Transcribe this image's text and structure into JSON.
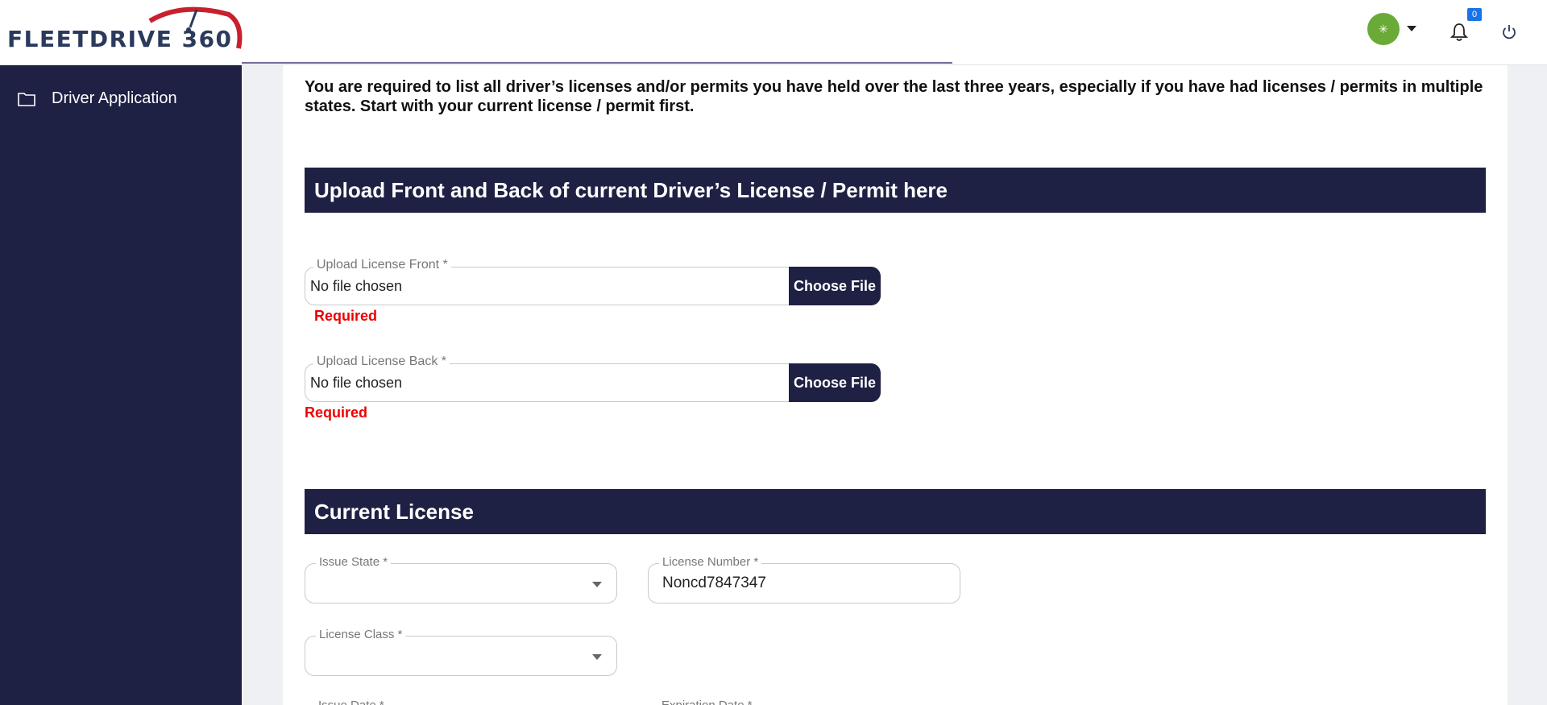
{
  "header": {
    "logo_text": "FLEETDRIVE 360",
    "avatar_symbol": "✳",
    "notification_count": "0",
    "brand_color": "#1f2144",
    "accent_red": "#c8202f"
  },
  "sidebar": {
    "items": [
      {
        "label": "Driver Application",
        "icon": "folder-icon"
      }
    ]
  },
  "main": {
    "intro_text": "You are required to list all driver’s licenses and/or permits you have held over the last three years, especially if you have had licenses / permits in multiple states. Start with your current license / permit first.",
    "upload_section": {
      "title": "Upload Front and Back of current Driver’s License / Permit here",
      "front": {
        "label": "Upload License Front *",
        "value": "No file chosen",
        "button": "Choose File",
        "error": "Required"
      },
      "back": {
        "label": "Upload License Back *",
        "value": "No file chosen",
        "button": "Choose File",
        "error": "Required"
      }
    },
    "current_license": {
      "title": "Current License",
      "issue_state": {
        "label": "Issue State *",
        "value": ""
      },
      "license_number": {
        "label": "License Number *",
        "value": "Noncd7847347"
      },
      "license_class": {
        "label": "License Class *",
        "value": ""
      },
      "issue_date_label": "Issue Date *",
      "expiration_date_label": "Expiration Date *"
    }
  }
}
